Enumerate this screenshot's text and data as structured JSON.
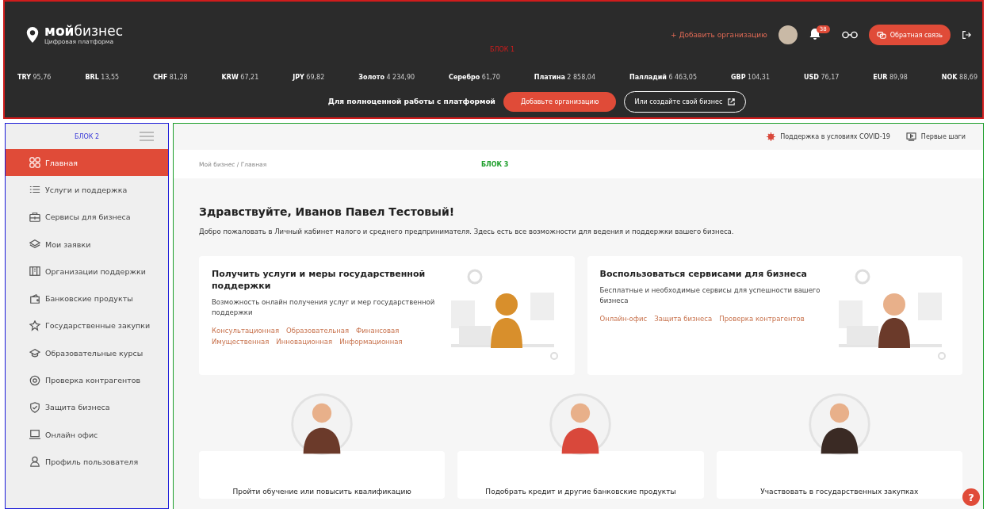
{
  "header": {
    "annotation": "БЛОК 1",
    "logo": "**мой**бизнес",
    "logo_subtitle": "Цифровая платформа",
    "add_organization": "+ Добавить организацию",
    "notifications_count": "38",
    "feedback_button": "Обратная связь"
  },
  "tickers": [
    {
      "code": "TRY",
      "value": "95,76"
    },
    {
      "code": "BRL",
      "value": "13,55"
    },
    {
      "code": "CHF",
      "value": "81,28"
    },
    {
      "code": "KRW",
      "value": "67,21"
    },
    {
      "code": "JPY",
      "value": "69,82"
    },
    {
      "code": "Золото",
      "value": "4 234,90"
    },
    {
      "code": "Серебро",
      "value": "61,70"
    },
    {
      "code": "Платина",
      "value": "2 858,04"
    },
    {
      "code": "Палладий",
      "value": "6 463,05"
    },
    {
      "code": "GBP",
      "value": "104,31"
    },
    {
      "code": "USD",
      "value": "76,17"
    },
    {
      "code": "EUR",
      "value": "89,98"
    },
    {
      "code": "NOK",
      "value": "88,69"
    }
  ],
  "cta": {
    "text": "Для полноценной работы с платформой",
    "primary_button": "Добавьте организацию",
    "secondary_button": "Или создайте свой бизнес"
  },
  "sidebar": {
    "annotation": "БЛОК 2",
    "items": [
      {
        "label": "Главная",
        "selected": true
      },
      {
        "label": "Услуги и поддержка",
        "selected": false
      },
      {
        "label": "Сервисы для бизнеса",
        "selected": false
      },
      {
        "label": "Мои заявки",
        "selected": false
      },
      {
        "label": "Организации поддержки",
        "selected": false
      },
      {
        "label": "Банковские продукты",
        "selected": false
      },
      {
        "label": "Государственные закупки",
        "selected": false
      },
      {
        "label": "Образовательные курсы",
        "selected": false
      },
      {
        "label": "Проверка контрагентов",
        "selected": false
      },
      {
        "label": "Защита бизнеса",
        "selected": false
      },
      {
        "label": "Онлайн офис",
        "selected": false
      },
      {
        "label": "Профиль пользователя",
        "selected": false
      }
    ]
  },
  "main": {
    "top_links": [
      "Поддержка в условиях COVID-19",
      "Первые шаги"
    ],
    "breadcrumb": "Мой бизнес / Главная",
    "annotation": "БЛОК 3",
    "greeting": "Здравствуйте, Иванов Павел Тестовый!",
    "welcome": "Добро пожаловать в Личный кабинет малого и среднего предпринимателя. Здесь есть все возможности для ведения и поддержки вашего бизнеса.",
    "cards": [
      {
        "title": "Получить услуги и меры государственной поддержки",
        "description": "Возможность онлайн получения услуг и мер государственной поддержки",
        "tags": [
          "Консультационная",
          "Образовательная",
          "Финансовая",
          "Имущественная",
          "Инновационная",
          "Информационная"
        ]
      },
      {
        "title": "Воспользоваться сервисами для бизнеса",
        "description": "Бесплатные и необходимые сервисы для успешности вашего бизнеса",
        "tags": [
          "Онлайн-офис",
          "Защита бизнеса",
          "Проверка контрагентов"
        ]
      }
    ],
    "bottom_cards": [
      {
        "title": "Пройти обучение или повысить квалификацию"
      },
      {
        "title": "Подобрать кредит и другие банковские продукты"
      },
      {
        "title": "Участвовать в государственных закупках"
      }
    ],
    "help_button": "?"
  }
}
